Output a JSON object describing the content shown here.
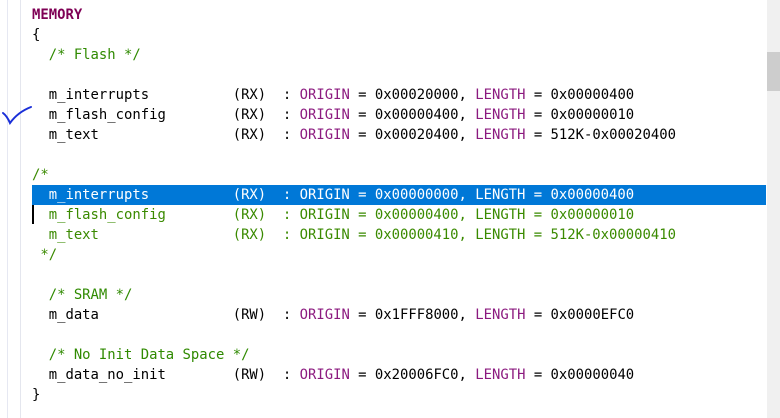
{
  "colors": {
    "keyword": "#7f0055",
    "attribute": "#8b1a7f",
    "comment": "#2f8a00",
    "selection": "#0078d7"
  },
  "selected_line": 9,
  "lines": [
    [
      {
        "t": "MEMORY",
        "c": "kw"
      }
    ],
    [
      {
        "t": "{",
        "c": ""
      }
    ],
    [
      {
        "t": "  /* Flash */",
        "c": "cm"
      }
    ],
    [],
    [
      {
        "t": "  m_interrupts          (RX)  : ",
        "c": ""
      },
      {
        "t": "ORIGIN",
        "c": "attr"
      },
      {
        "t": " = 0x00020000, ",
        "c": ""
      },
      {
        "t": "LENGTH",
        "c": "attr"
      },
      {
        "t": " = 0x00000400",
        "c": ""
      }
    ],
    [
      {
        "t": "  m_flash_config        (RX)  : ",
        "c": ""
      },
      {
        "t": "ORIGIN",
        "c": "attr"
      },
      {
        "t": " = 0x00000400, ",
        "c": ""
      },
      {
        "t": "LENGTH",
        "c": "attr"
      },
      {
        "t": " = 0x00000010",
        "c": ""
      }
    ],
    [
      {
        "t": "  m_text                (RX)  : ",
        "c": ""
      },
      {
        "t": "ORIGIN",
        "c": "attr"
      },
      {
        "t": " = 0x00020400, ",
        "c": ""
      },
      {
        "t": "LENGTH",
        "c": "attr"
      },
      {
        "t": " = 512K-0x00020400",
        "c": ""
      }
    ],
    [],
    [
      {
        "t": "/*",
        "c": "cmb"
      }
    ],
    [
      {
        "t": "  m_interrupts          (RX)  : ORIGIN = 0x00000000, LENGTH = 0x00000400",
        "c": "cmb"
      }
    ],
    [
      {
        "t": "  m_flash_config        (RX)  : ORIGIN = 0x00000400, LENGTH = 0x00000010",
        "c": "cmb"
      }
    ],
    [
      {
        "t": "  m_text                (RX)  : ORIGIN = 0x00000410, LENGTH = 512K-0x00000410",
        "c": "cmb"
      }
    ],
    [
      {
        "t": " */",
        "c": "cmb"
      }
    ],
    [],
    [
      {
        "t": "  /* SRAM */",
        "c": "cm"
      }
    ],
    [
      {
        "t": "  m_data                (RW)  : ",
        "c": ""
      },
      {
        "t": "ORIGIN",
        "c": "attr"
      },
      {
        "t": " = 0x1FFF8000, ",
        "c": ""
      },
      {
        "t": "LENGTH",
        "c": "attr"
      },
      {
        "t": " = 0x0000EFC0",
        "c": ""
      }
    ],
    [],
    [
      {
        "t": "  /* No Init Data Space */",
        "c": "cm"
      }
    ],
    [
      {
        "t": "  m_data_no_init        (RW)  : ",
        "c": ""
      },
      {
        "t": "ORIGIN",
        "c": "attr"
      },
      {
        "t": " = 0x20006FC0, ",
        "c": ""
      },
      {
        "t": "LENGTH",
        "c": "attr"
      },
      {
        "t": " = 0x00000040",
        "c": ""
      }
    ],
    [
      {
        "t": "}",
        "c": ""
      }
    ]
  ]
}
